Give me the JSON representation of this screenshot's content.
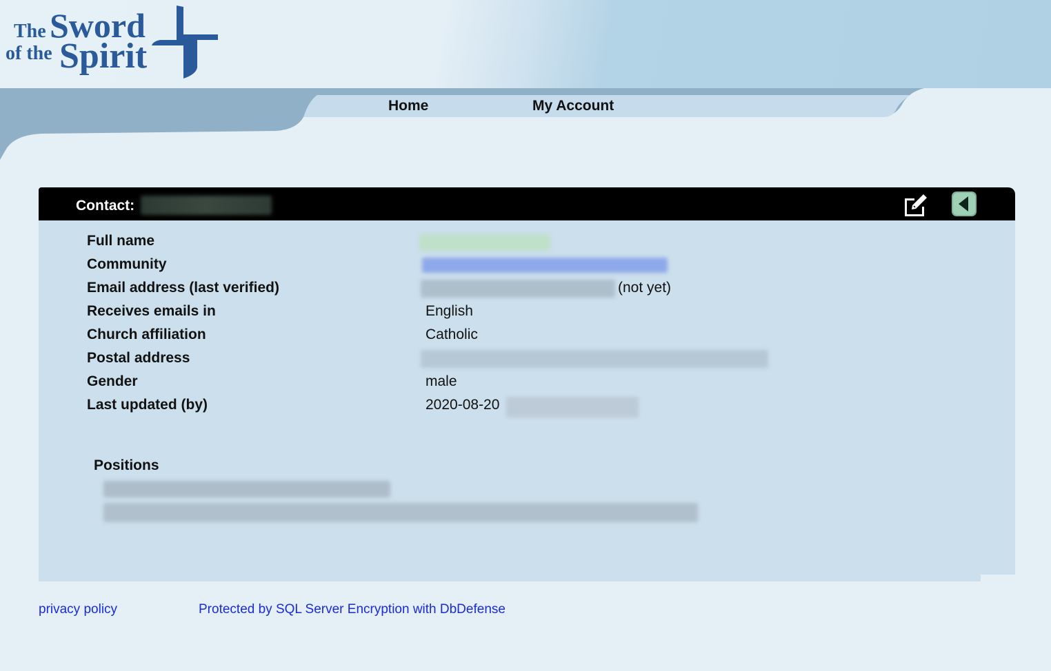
{
  "logo": {
    "line1_a": "The",
    "line1_b": "Sword",
    "line2_a": "of the",
    "line2_b": "Spirit",
    "icon": "cross-icon",
    "brand_color": "#2a5a9a"
  },
  "nav": {
    "home_label": "Home",
    "account_label": "My Account",
    "swoosh_color": "#8fb0c7"
  },
  "contact": {
    "header_label": "Contact:",
    "edit_icon": "edit-icon",
    "back_icon": "back-arrow-icon",
    "fields": {
      "full_name_label": "Full name",
      "community_label": "Community",
      "email_label": "Email address (last verified)",
      "email_status": "(not yet)",
      "language_label": "Receives emails in",
      "language_value": "English",
      "church_label": "Church affiliation",
      "church_value": "Catholic",
      "postal_label": "Postal address",
      "gender_label": "Gender",
      "gender_value": "male",
      "updated_label": "Last updated (by)",
      "updated_date": "2020-08-20"
    },
    "positions_label": "Positions"
  },
  "footer": {
    "privacy_label": "privacy policy",
    "protected_label": "Protected by SQL Server Encryption with DbDefense",
    "link_color": "#1a2bd6"
  }
}
